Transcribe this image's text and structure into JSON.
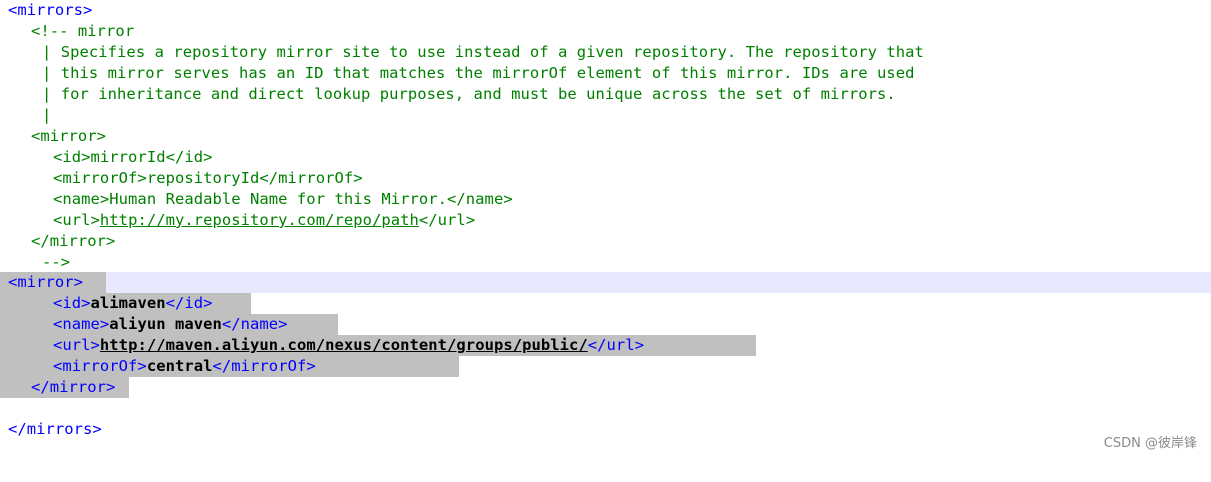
{
  "code": {
    "open_mirrors": "<mirrors>",
    "comment_open": "<!-- mirror",
    "comment_line1": "| Specifies a repository mirror site to use instead of a given repository. The repository that",
    "comment_line2": "| this mirror serves has an ID that matches the mirrorOf element of this mirror. IDs are used",
    "comment_line3": "| for inheritance and direct lookup purposes, and must be unique across the set of mirrors.",
    "comment_line4": "|",
    "example_open": "<mirror>",
    "example_id": "<id>mirrorId</id>",
    "example_mirrorof": "<mirrorOf>repositoryId</mirrorOf>",
    "example_name": "<name>Human Readable Name for this Mirror.</name>",
    "example_url_open": "<url>",
    "example_url_value": "http://my.repository.com/repo/path",
    "example_url_close": "</url>",
    "example_close": "</mirror>",
    "comment_close": "-->",
    "mirror_open": "<mirror>",
    "id_open": "<id>",
    "id_value": "alimaven",
    "id_close": "</id>",
    "name_open": "<name>",
    "name_value": "aliyun maven",
    "name_close": "</name>",
    "url_open": "<url>",
    "url_value": "http://maven.aliyun.com/nexus/content/groups/public/",
    "url_close": "</url>",
    "mirrorof_open": "<mirrorOf>",
    "mirrorof_value": "central",
    "mirrorof_close": "</mirrorOf>",
    "mirror_close": "</mirror>",
    "close_mirrors": "</mirrors>"
  },
  "watermark": "CSDN @彼岸锋",
  "colors": {
    "tag": "#0000ff",
    "comment": "#008000",
    "selection": "#c0c0c0",
    "current_line": "#e8e8ff"
  }
}
